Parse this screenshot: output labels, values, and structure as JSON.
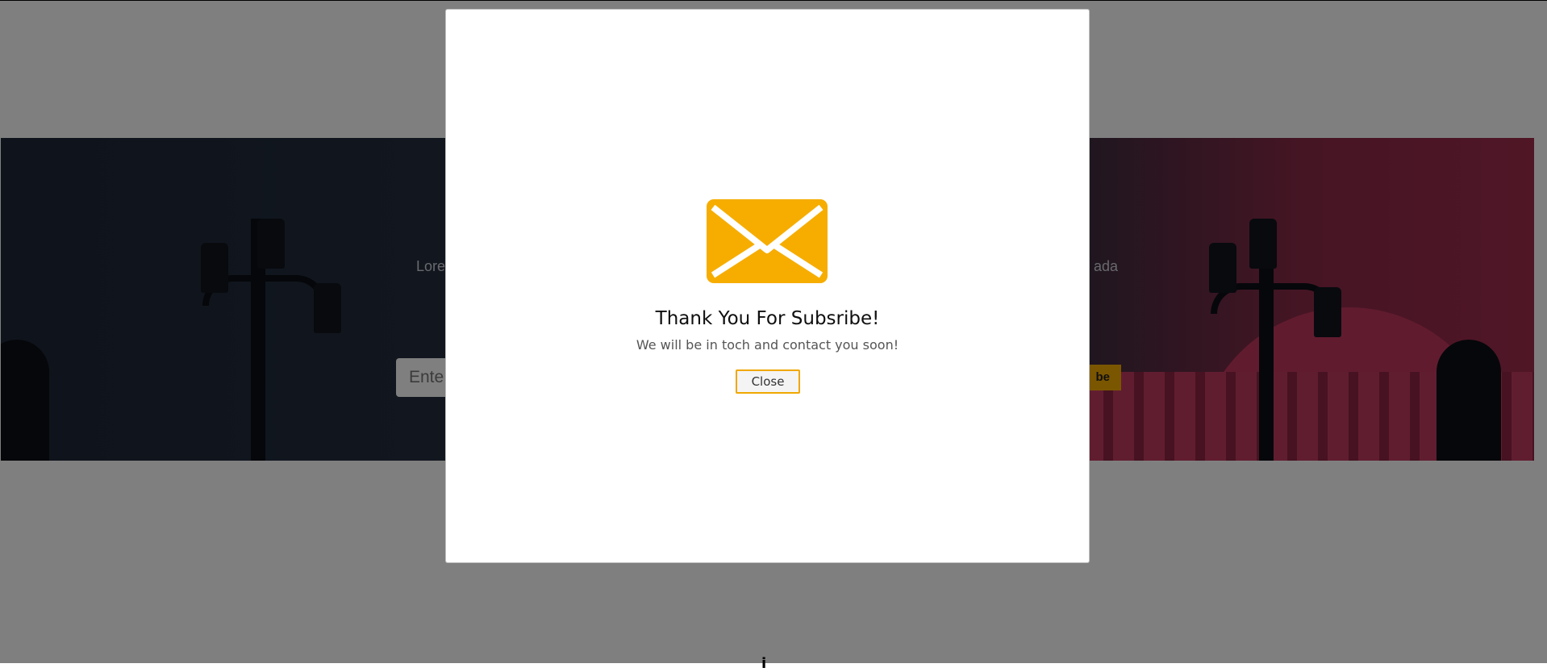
{
  "page": {
    "hero": {
      "text_left": "Lore",
      "text_right": "ada",
      "email_placeholder": "Ente",
      "subscribe_button_label": "be"
    },
    "below_glyph": "i"
  },
  "modal": {
    "icon": "envelope-icon",
    "title": "Thank You For Subsribe!",
    "message": "We will be in toch and contact you soon!",
    "close_label": "Close"
  },
  "colors": {
    "accent": "#f6ad00",
    "backdrop": "rgba(0,0,0,0.5)",
    "modal_background": "#ffffff"
  }
}
